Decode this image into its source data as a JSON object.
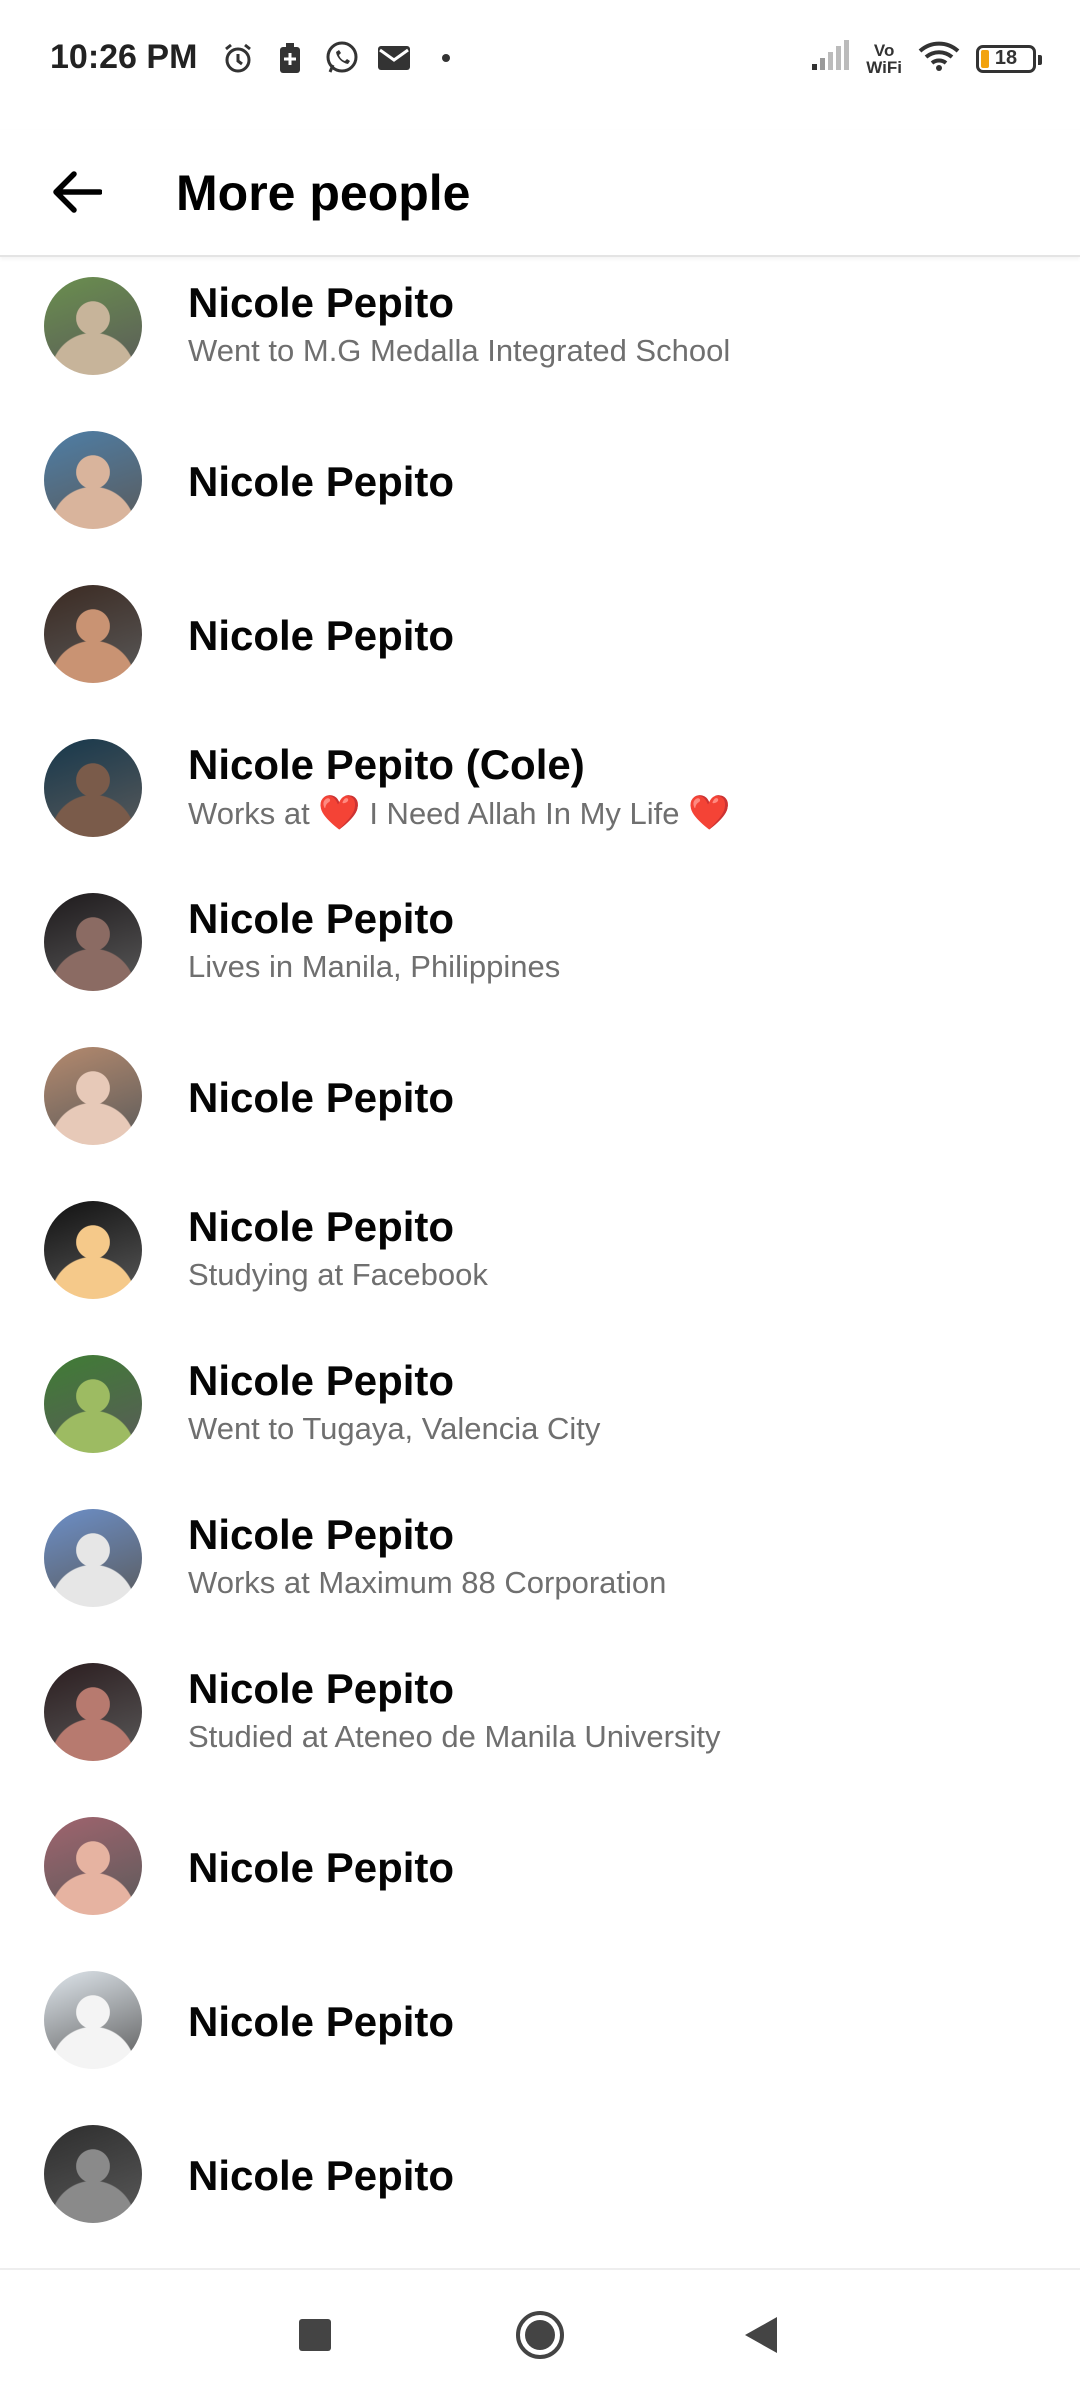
{
  "status_bar": {
    "time": "10:26 PM",
    "icons": [
      "alarm-icon",
      "battery-saver-icon",
      "whatsapp-icon",
      "mail-icon",
      "dot-icon"
    ],
    "network_label": "Vo\nWiFi",
    "battery_level": "18"
  },
  "header": {
    "title": "More people",
    "back_icon": "arrow-left-icon"
  },
  "people": [
    {
      "name": "Nicole Pepito",
      "subtitle": "Went to M.G Medalla Integrated School"
    },
    {
      "name": "Nicole Pepito",
      "subtitle": ""
    },
    {
      "name": "Nicole Pepito",
      "subtitle": ""
    },
    {
      "name": "Nicole Pepito (Cole)",
      "subtitle_prefix": "Works at",
      "subtitle_mid": "I Need Allah In My Life",
      "heart": "❤️"
    },
    {
      "name": "Nicole Pepito",
      "subtitle": "Lives in Manila, Philippines"
    },
    {
      "name": "Nicole Pepito",
      "subtitle": ""
    },
    {
      "name": "Nicole Pepito",
      "subtitle": "Studying at Facebook"
    },
    {
      "name": "Nicole Pepito",
      "subtitle": "Went to Tugaya, Valencia City"
    },
    {
      "name": "Nicole Pepito",
      "subtitle": "Works at Maximum 88 Corporation"
    },
    {
      "name": "Nicole Pepito",
      "subtitle": "Studied at Ateneo de Manila University"
    },
    {
      "name": "Nicole Pepito",
      "subtitle": ""
    },
    {
      "name": "Nicole Pepito",
      "subtitle": ""
    },
    {
      "name": "Nicole Pepito",
      "subtitle": ""
    }
  ],
  "nav_bar": {
    "icons": [
      "recents-square-icon",
      "home-circle-icon",
      "back-triangle-icon"
    ]
  },
  "colors": {
    "name_text": "#050505",
    "subtitle_text": "#6f6f6f",
    "battery_fill": "#f2a30f",
    "heart": "#e0202e"
  }
}
